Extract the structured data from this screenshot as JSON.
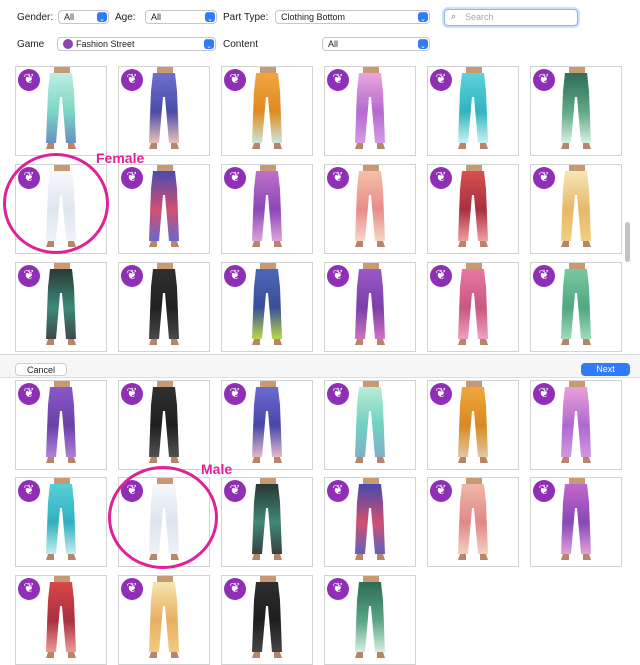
{
  "filters": {
    "gender": {
      "label": "Gender:",
      "value": "All"
    },
    "age": {
      "label": "Age:",
      "value": "All"
    },
    "part_type": {
      "label": "Part Type:",
      "value": "Clothing Bottom"
    },
    "game": {
      "label": "Game",
      "value": "Fashion Street"
    },
    "content": {
      "label": "Content",
      "value": "All"
    }
  },
  "search": {
    "placeholder": "Search",
    "value": ""
  },
  "footer": {
    "cancel_label": "Cancel",
    "next_label": "Next"
  },
  "annotations": {
    "female": "Female",
    "male": "Male"
  },
  "colors": {
    "accent": "#2f7cf6",
    "badge": "#8e2fb5",
    "annotation": "#e0219a"
  },
  "item_grid_top": [
    {
      "style": "mint-floral",
      "colors": [
        "#bfeee0",
        "#7ad6c4",
        "#6a8fc2"
      ]
    },
    {
      "style": "indigo-border",
      "colors": [
        "#6f6fd0",
        "#4b4ba8",
        "#e9c0b8"
      ]
    },
    {
      "style": "orange-border",
      "colors": [
        "#f0a640",
        "#e08a20",
        "#c9e6d8"
      ]
    },
    {
      "style": "pink-purple",
      "colors": [
        "#e9a6da",
        "#b46ad0",
        "#d49ae8"
      ]
    },
    {
      "style": "teal-fade",
      "colors": [
        "#5fd2d8",
        "#2fb4c0",
        "#c9f2f2"
      ]
    },
    {
      "style": "green-fade",
      "colors": [
        "#2f6e58",
        "#5fa886",
        "#d9f0e2"
      ]
    },
    {
      "style": "white-satin",
      "colors": [
        "#f6f8fc",
        "#dfe6f0",
        "#eef2f8"
      ]
    },
    {
      "style": "navy-floral",
      "colors": [
        "#4a4ab0",
        "#d05070",
        "#6868c8"
      ]
    },
    {
      "style": "purple-floral",
      "colors": [
        "#c070c8",
        "#8a48b8",
        "#e0a0d8"
      ]
    },
    {
      "style": "peach-pattern",
      "colors": [
        "#f4c0a8",
        "#e88c8c",
        "#f6d6c4"
      ]
    },
    {
      "style": "red-floral",
      "colors": [
        "#d85050",
        "#a83040",
        "#f0a0a0"
      ]
    },
    {
      "style": "cream-floral",
      "colors": [
        "#f6e6b8",
        "#e8b868",
        "#f0d080"
      ]
    },
    {
      "style": "black-teal",
      "colors": [
        "#2a3a34",
        "#3a8a7a",
        "#404848"
      ]
    },
    {
      "style": "black-plain",
      "colors": [
        "#303030",
        "#202020",
        "#484848"
      ]
    },
    {
      "style": "blue-wrap",
      "colors": [
        "#4a68b8",
        "#3a4e98",
        "#b8d848"
      ]
    },
    {
      "style": "purple-wrap",
      "colors": [
        "#9a58c8",
        "#7a40a8",
        "#d070c0"
      ]
    },
    {
      "style": "pink-wrap",
      "colors": [
        "#e878a0",
        "#c85880",
        "#f0a0c0"
      ]
    },
    {
      "style": "green-wrap",
      "colors": [
        "#78c8a0",
        "#50a880",
        "#a0d8b8"
      ]
    }
  ],
  "item_grid_bottom": [
    {
      "style": "purple-wrap",
      "colors": [
        "#8a58c8",
        "#6a40a8",
        "#b080d8"
      ]
    },
    {
      "style": "black-wrap",
      "colors": [
        "#303030",
        "#202020",
        "#505050"
      ]
    },
    {
      "style": "indigo-border",
      "colors": [
        "#6a6ad0",
        "#4848a8",
        "#e0b8c8"
      ]
    },
    {
      "style": "mint-floral",
      "colors": [
        "#b8ecd8",
        "#70d0c0",
        "#80b0c8"
      ]
    },
    {
      "style": "orange-border",
      "colors": [
        "#f0a640",
        "#d88a20",
        "#e0c8a0"
      ]
    },
    {
      "style": "pink-purple",
      "colors": [
        "#e8a0d8",
        "#b068d0",
        "#d098e0"
      ]
    },
    {
      "style": "teal-fade",
      "colors": [
        "#58d0d8",
        "#30b0c0",
        "#c0f0f0"
      ]
    },
    {
      "style": "white-satin",
      "colors": [
        "#f6f8fc",
        "#dde4ee",
        "#eef2f8"
      ]
    },
    {
      "style": "black-teal",
      "colors": [
        "#283830",
        "#408878",
        "#384040"
      ]
    },
    {
      "style": "navy-floral",
      "colors": [
        "#4848b0",
        "#d05070",
        "#6060c0"
      ]
    },
    {
      "style": "peach-pattern",
      "colors": [
        "#f0b8a8",
        "#e08888",
        "#f4d0c0"
      ]
    },
    {
      "style": "purple-floral",
      "colors": [
        "#c068c8",
        "#8848b8",
        "#e0a0d8"
      ]
    },
    {
      "style": "red-floral",
      "colors": [
        "#d84848",
        "#a83040",
        "#f09898"
      ]
    },
    {
      "style": "cream-floral",
      "colors": [
        "#f6e4b0",
        "#e8b060",
        "#f0cc80"
      ]
    },
    {
      "style": "black-plain",
      "colors": [
        "#2e2e2e",
        "#1e1e1e",
        "#464646"
      ]
    },
    {
      "style": "green-fade",
      "colors": [
        "#2c6c56",
        "#5aa484",
        "#d6eee0"
      ]
    }
  ]
}
